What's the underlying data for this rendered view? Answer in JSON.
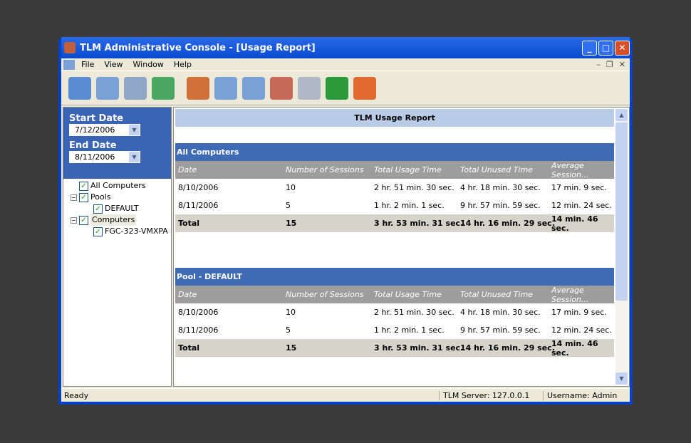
{
  "window": {
    "title": "TLM Administrative Console - [Usage Report]"
  },
  "menu": [
    "File",
    "View",
    "Window",
    "Help"
  ],
  "toolbar": [
    {
      "icon": "report-icon",
      "color": "#5b8bd0"
    },
    {
      "icon": "report-detail-icon",
      "color": "#7aa0d8"
    },
    {
      "icon": "grid-icon",
      "color": "#8fa6c8"
    },
    {
      "icon": "ticket-icon",
      "color": "#4aa860"
    },
    {
      "icon": "users-icon",
      "color": "#d0703a"
    },
    {
      "icon": "report-back-icon",
      "color": "#7aa0d8"
    },
    {
      "icon": "report-settings-icon",
      "color": "#7aa0d8"
    },
    {
      "icon": "report-delete-icon",
      "color": "#c86a5a"
    },
    {
      "icon": "printer-icon",
      "color": "#b0b8c8"
    },
    {
      "icon": "refresh-icon",
      "color": "#2a9a3a"
    },
    {
      "icon": "help-icon",
      "color": "#e06a30"
    }
  ],
  "filters": {
    "start_label": "Start Date",
    "start_value": "7/12/2006",
    "end_label": "End Date",
    "end_value": "8/11/2006"
  },
  "tree": {
    "all": "All Computers",
    "pools": "Pools",
    "default": "DEFAULT",
    "computers": "Computers",
    "pc": "FGC-323-VMXPA"
  },
  "report": {
    "title": "TLM Usage Report",
    "columns": [
      "Date",
      "Number of Sessions",
      "Total Usage Time",
      "Total Unused Time",
      "Average Session..."
    ],
    "sections": [
      {
        "name": "All Computers",
        "rows": [
          [
            "8/10/2006",
            "10",
            "2 hr. 51 min. 30 sec.",
            "4 hr. 18 min. 30 sec.",
            "17 min. 9 sec."
          ],
          [
            "8/11/2006",
            "5",
            "1 hr. 2 min. 1 sec.",
            "9 hr. 57 min. 59 sec.",
            "12 min. 24 sec."
          ]
        ],
        "total": [
          "Total",
          "15",
          "3 hr. 53 min. 31 sec.",
          "14 hr. 16 min. 29 sec.",
          "14 min. 46 sec."
        ]
      },
      {
        "name": "Pool - DEFAULT",
        "rows": [
          [
            "8/10/2006",
            "10",
            "2 hr. 51 min. 30 sec.",
            "4 hr. 18 min. 30 sec.",
            "17 min. 9 sec."
          ],
          [
            "8/11/2006",
            "5",
            "1 hr. 2 min. 1 sec.",
            "9 hr. 57 min. 59 sec.",
            "12 min. 24 sec."
          ]
        ],
        "total": [
          "Total",
          "15",
          "3 hr. 53 min. 31 sec.",
          "14 hr. 16 min. 29 sec.",
          "14 min. 46 sec."
        ]
      }
    ]
  },
  "status": {
    "state": "Ready",
    "server": "TLM Server:  127.0.0.1",
    "user": "Username:  Admin"
  }
}
